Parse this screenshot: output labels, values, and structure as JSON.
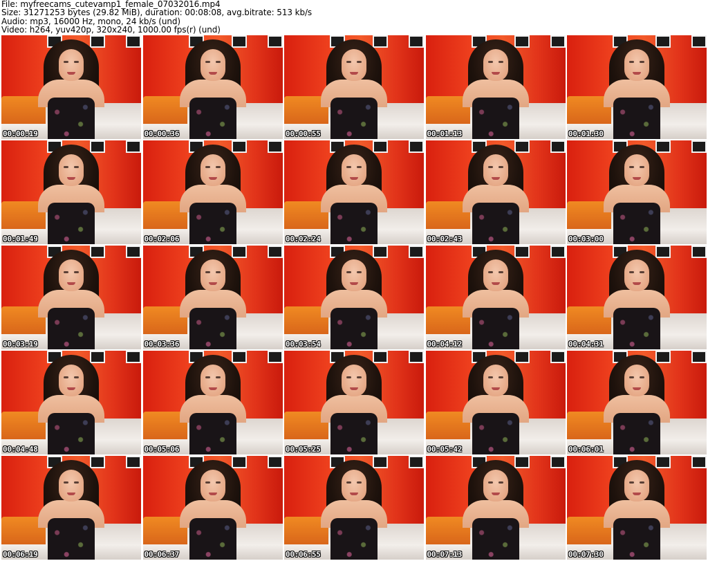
{
  "header": {
    "file_line": "File: myfreecams_cutevamp1_female_07032016.mp4",
    "size_line": "Size: 31271253 bytes (29.82 MiB), duration: 00:08:08, avg.bitrate: 513 kb/s",
    "audio_line": "Audio: mp3, 16000 Hz, mono, 24 kb/s (und)",
    "video_line": "Video: h264, yuv420p, 320x240, 1000.00 fps(r) (und)"
  },
  "thumbnails": [
    {
      "timestamp": "00:00:19"
    },
    {
      "timestamp": "00:00:36"
    },
    {
      "timestamp": "00:00:55"
    },
    {
      "timestamp": "00:01:13"
    },
    {
      "timestamp": "00:01:30"
    },
    {
      "timestamp": "00:01:49"
    },
    {
      "timestamp": "00:02:06"
    },
    {
      "timestamp": "00:02:24"
    },
    {
      "timestamp": "00:02:43"
    },
    {
      "timestamp": "00:03:00"
    },
    {
      "timestamp": "00:03:19"
    },
    {
      "timestamp": "00:03:36"
    },
    {
      "timestamp": "00:03:54"
    },
    {
      "timestamp": "00:04:12"
    },
    {
      "timestamp": "00:04:31"
    },
    {
      "timestamp": "00:04:48"
    },
    {
      "timestamp": "00:05:06"
    },
    {
      "timestamp": "00:05:25"
    },
    {
      "timestamp": "00:05:42"
    },
    {
      "timestamp": "00:06:01"
    },
    {
      "timestamp": "00:06:19"
    },
    {
      "timestamp": "00:06:37"
    },
    {
      "timestamp": "00:06:55"
    },
    {
      "timestamp": "00:07:13"
    },
    {
      "timestamp": "00:07:30"
    }
  ],
  "colors": {
    "background": "#ffffff",
    "wall": "#e8321c",
    "timestamp_text": "#ffffff"
  }
}
